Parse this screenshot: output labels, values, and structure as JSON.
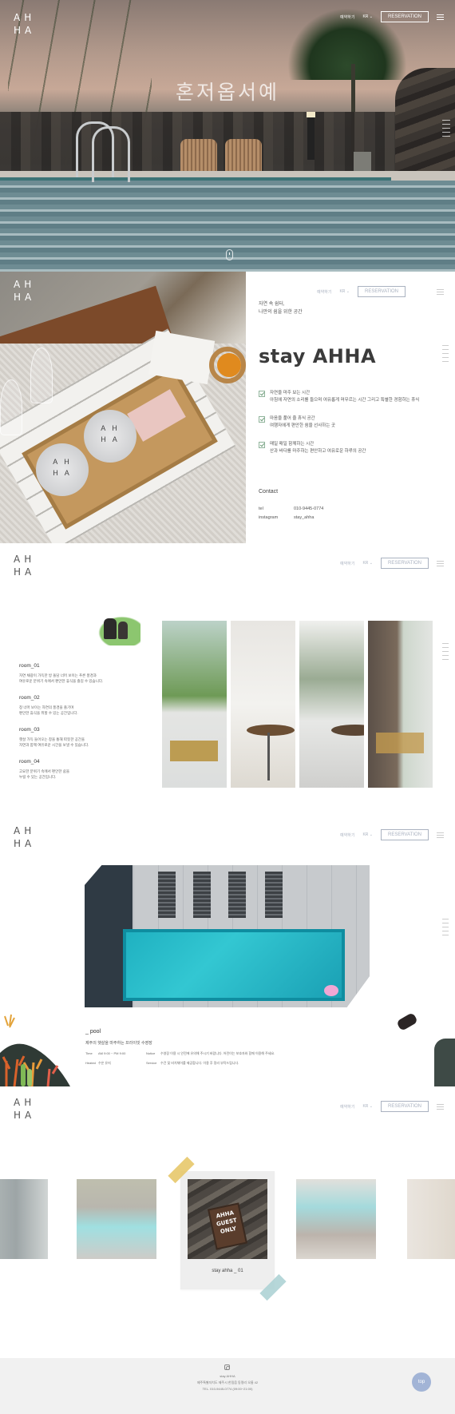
{
  "header": {
    "logo_line1": "AH",
    "logo_line2": "HA",
    "link_book": "예약하기",
    "link_lang": "KR",
    "reservation_label": "RESERVATION"
  },
  "hero": {
    "title": "혼저옵서예"
  },
  "stay": {
    "subtitle_line1": "자연 속 쉼터,",
    "subtitle_line2": "나만의 쉼을 위한 공간",
    "title": "stay AHHA",
    "features": [
      "자연을 마주 보는 시간\n아침에 자연의 소리를 들으며 여유롭게 머무르는 시간 그리고 특별한 경험하는 휴식",
      "마음을 풀어 줄 휴식 공간\n여행자에게 편안한 쉼을 선사하는 곳",
      "매일 매일 함께하는 시간\n산과 바다를 마주하는 편안하고 여유로운 하루의 공간"
    ],
    "tin_label_1": "A H",
    "tin_label_2": "H A",
    "contact_heading": "Contact",
    "contact": [
      {
        "label": "tel",
        "value": "010-9445-0774"
      },
      {
        "label": "instagram",
        "value": "stay_ahha"
      }
    ]
  },
  "rooms": {
    "list": [
      {
        "name": "room_01",
        "desc": "자연 채광이 가득한 방 돌담 너머 보이는 푸른 풍경과\n여유로운 분위기 속에서 편안한 휴식을 즐길 수 있습니다."
      },
      {
        "name": "room_02",
        "desc": "창 너머 보이는 자연의 풍경을 즐기며\n편안한 휴식을 취할 수 있는 공간입니다."
      },
      {
        "name": "room_03",
        "desc": "햇살 가득 들어오는 창을 통해 따뜻한 공간을\n자연과 함께 여유로운 시간을 보낼 수 있습니다."
      },
      {
        "name": "room_04",
        "desc": "고요한 분위기 속에서 편안한 쉼을\n누릴 수 있는 공간입니다."
      }
    ]
  },
  "pool": {
    "label": "_ pool",
    "subtitle": "제주의 햇살을 마주하는 프라이빗 수영장",
    "rows": [
      {
        "k1": "Time",
        "v1": "AM 9:00 ~ PM 9:00",
        "k2": "Notice",
        "v2": "수영장 이용 시 안전에 유의해 주시기 바랍니다. 어린이는 보호자와 함께 이용해 주세요."
      },
      {
        "k1": "Heated",
        "v1": "수온 유지",
        "k2": "Service",
        "v2": "수건 및 비치체어를 제공합니다. 이용 후 정리 부탁드립니다."
      }
    ]
  },
  "gallery": {
    "caption": "stay ahha _ 01",
    "sign_text": "AHHA GUEST ONLY"
  },
  "footer": {
    "name": "stay AHHA",
    "address": "제주특별자치도 제주시 한림읍 동명리 오름 42",
    "tel": "TEL. 010-9445-0774 (09:00~21:00)",
    "top_label": "top"
  },
  "colors": {
    "accent": "#a2b4d6",
    "check": "#8fb39a",
    "pool_water": "#1fb1c1"
  }
}
